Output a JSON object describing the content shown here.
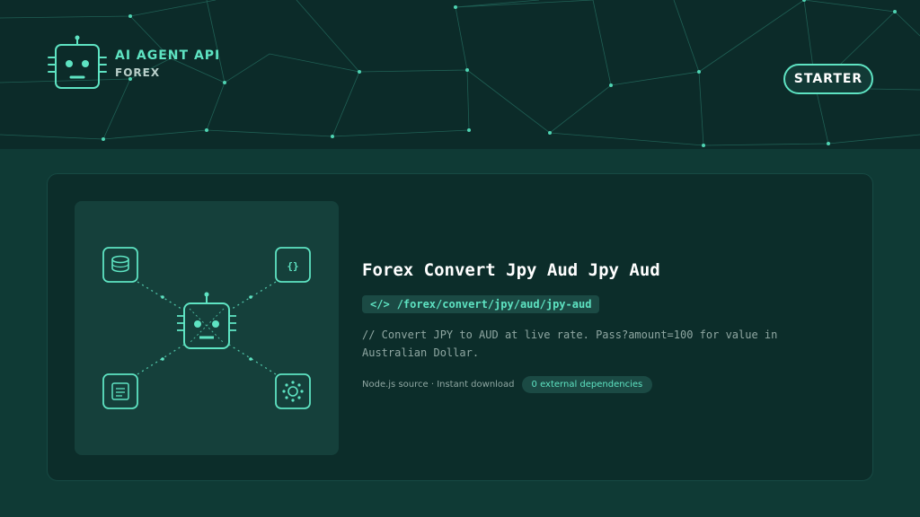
{
  "header": {
    "brand_title": "AI AGENT API",
    "brand_subtitle": "FOREX",
    "plan_label": "STARTER",
    "logo_icon": "robot-icon"
  },
  "card": {
    "title": "Forex Convert Jpy Aud Jpy Aud",
    "endpoint_icon": "</>",
    "endpoint_path": "/forex/convert/jpy/aud/jpy-aud",
    "description": "// Convert JPY to AUD at live rate. Pass?amount=100 for value in Australian Dollar.",
    "meta_text": "Node.js source · Instant download",
    "dependency_badge": "0 external dependencies",
    "illustration": {
      "nodes": [
        "database-icon",
        "code-braces-icon",
        "document-icon",
        "network-hub-icon"
      ],
      "center": "robot-icon",
      "braces_label": "{}"
    }
  },
  "colors": {
    "accent": "#5ee3c2",
    "header_bg": "#0c2b29",
    "page_bg": "#0f3a35",
    "card_bg": "#0c2d2a"
  }
}
